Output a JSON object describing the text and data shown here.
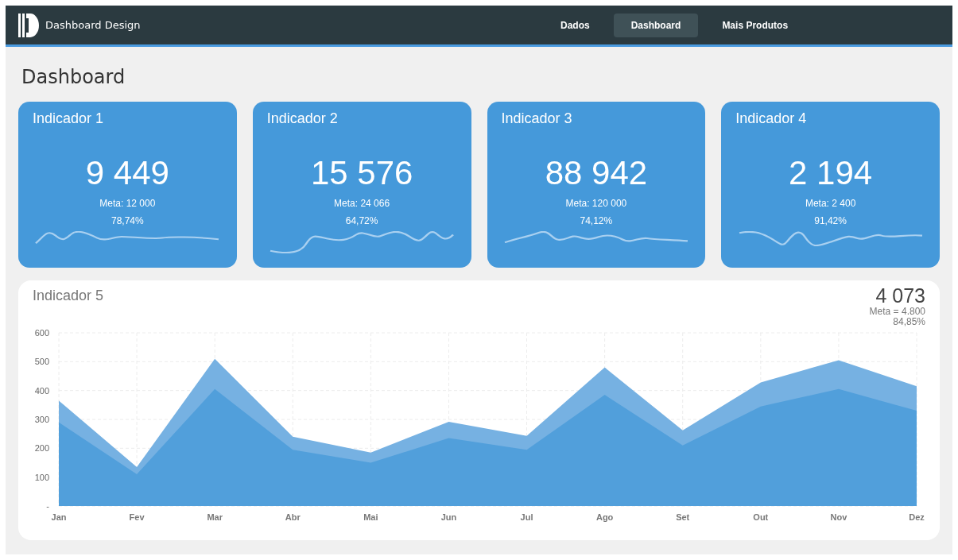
{
  "brand": {
    "name": "Dashboard Design"
  },
  "nav": [
    {
      "label": "Dados",
      "selected": false
    },
    {
      "label": "Dashboard",
      "selected": true
    },
    {
      "label": "Mais Produtos",
      "selected": false
    }
  ],
  "page_title": "Dashboard",
  "indicators": [
    {
      "title": "Indicador 1",
      "value": "9 449",
      "meta": "Meta: 12 000",
      "percent": "78,74%"
    },
    {
      "title": "Indicador 2",
      "value": "15 576",
      "meta": "Meta: 24 066",
      "percent": "64,72%"
    },
    {
      "title": "Indicador 3",
      "value": "88 942",
      "meta": "Meta: 120 000",
      "percent": "74,12%"
    },
    {
      "title": "Indicador 4",
      "value": "2 194",
      "meta": "Meta: 2 400",
      "percent": "91,42%"
    }
  ],
  "main_indicator": {
    "title": "Indicador 5",
    "value": "4 073",
    "meta": "Meta = 4.800",
    "percent": "84,85%",
    "chart_data": {
      "type": "area",
      "categories": [
        "Jan",
        "Fev",
        "Mar",
        "Abr",
        "Mai",
        "Jun",
        "Jul",
        "Ago",
        "Set",
        "Out",
        "Nov",
        "Dez"
      ],
      "series": [
        {
          "color": "#76b1e2",
          "values": [
            365,
            135,
            510,
            240,
            185,
            292,
            243,
            480,
            262,
            428,
            505,
            415
          ]
        },
        {
          "color": "#519fdb",
          "values": [
            290,
            110,
            405,
            195,
            150,
            235,
            195,
            385,
            210,
            345,
            405,
            330
          ]
        }
      ],
      "grid": true,
      "ylim": [
        0,
        600
      ],
      "yticks": [
        {
          "value": 0,
          "label": "-"
        },
        100,
        200,
        300,
        400,
        500,
        600
      ]
    }
  }
}
